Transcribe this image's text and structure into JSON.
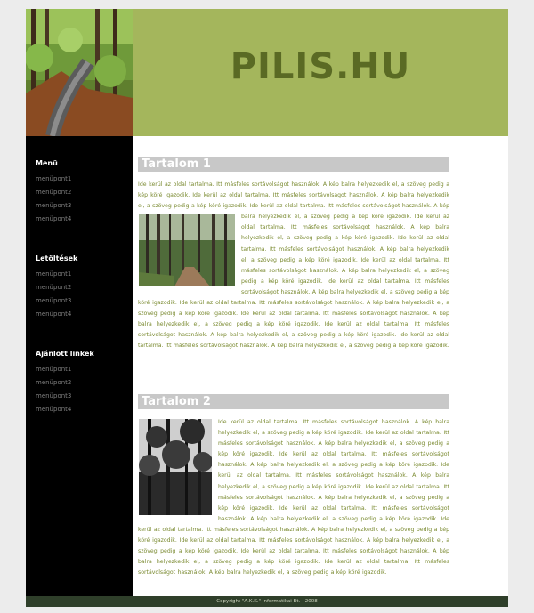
{
  "header": {
    "site_title": "PILIS.HU"
  },
  "sidebar": {
    "groups": [
      {
        "title": "Menü",
        "items": [
          "menüpont1",
          "menüpont2",
          "menüpont3",
          "menüpont4"
        ]
      },
      {
        "title": "Letöltések",
        "items": [
          "menüpont1",
          "menüpont2",
          "menüpont3",
          "menüpont4"
        ]
      },
      {
        "title": "Ajánlott linkek",
        "items": [
          "menüpont1",
          "menüpont2",
          "menüpont3",
          "menüpont4"
        ]
      }
    ]
  },
  "main": {
    "sections": [
      {
        "heading": "Tartalom 1",
        "intro": "Ide kerül az oldal tartalma. Itt másfeles sortávolságot használok. A kép balra helyezkedik el, a szöveg pedig a kép köré igazodik. Ide kerül az oldal tartalma. Itt másfeles sortávolságot használok. A kép balra helyezkedik el, a szöveg pedig a kép köré igazodik. Ide kerül az oldal tartalma. Itt másfeles sortávolságot használok. A kép balra helyezkedik el, a szöveg pedig a kép",
        "body": "köré igazodik. Ide kerül az oldal tartalma. Itt másfeles sortávolságot használok. A kép balra helyezkedik el, a szöveg pedig a kép köré igazodik. Ide kerül az oldal tartalma. Itt másfeles sortávolságot használok. A kép balra helyezkedik el, a szöveg pedig a kép köré igazodik. Ide kerül az oldal tartalma. Itt másfeles sortávolságot használok. A kép balra helyezkedik el, a szöveg pedig a kép köré igazodik. Ide kerül az oldal tartalma. Itt másfeles sortávolságot használok. A kép balra helyezkedik el, a szöveg pedig a kép köré igazodik. Ide kerül az oldal tartalma. Itt másfeles sortávolságot használok. A kép balra helyezkedik el, a szöveg pedig a kép köré igazodik. Ide kerül az oldal tartalma. Itt másfeles sortávolságot használok. A kép balra helyezkedik el, a szöveg pedig a kép köré igazodik. Ide kerül az oldal tartalma. Itt másfeles sortávolságot használok. A kép balra helyezkedik el, a szöveg pedig a kép köré igazodik. Ide kerül az oldal tartalma. Itt másfeles sortávolságot használok. A kép balra helyezkedik el, a szöveg pedig a kép köré igazodik."
      },
      {
        "heading": "Tartalom 2",
        "body": "Ide kerül az oldal tartalma. Itt másfeles sortávolságot használok. A kép balra helyezkedik el, a szöveg pedig a kép köré igazodik. Ide kerül az oldal tartalma. Itt másfeles sortávolságot használok. A kép balra helyezkedik el, a szöveg pedig a kép köré igazodik. Ide kerül az oldal tartalma. Itt másfeles sortávolságot használok. A kép balra helyezkedik el, a szöveg pedig a kép köré igazodik. Ide kerül az oldal tartalma. Itt másfeles sortávolságot használok. A kép balra helyezkedik el, a szöveg pedig a kép köré igazodik. Ide kerül az oldal tartalma. Itt másfeles sortávolságot használok. A kép balra helyezkedik el, a szöveg pedig a kép köré igazodik. Ide kerül az oldal tartalma. Itt másfeles sortávolságot használok. A kép balra helyezkedik el, a szöveg pedig a kép köré igazodik. Ide kerül az oldal tartalma. Itt másfeles sortávolságot használok. A kép balra helyezkedik el, a szöveg pedig a kép köré igazodik. Ide kerül az oldal tartalma. Itt másfeles sortávolságot használok. A kép balra helyezkedik el, a szöveg pedig a kép köré igazodik. Ide kerül az oldal tartalma. Itt másfeles sortávolságot használok. A kép balra helyezkedik el, a szöveg pedig a kép köré igazodik. Ide kerül az oldal tartalma. Itt másfeles sortávolságot használok. A kép balra helyezkedik el, a szöveg pedig a kép köré igazodik."
      }
    ]
  },
  "footer": {
    "text": "Copyright \"A.K.K.\" Informatikai Bt. - 2008"
  },
  "colors": {
    "header_band": "#a4b65c",
    "title": "#5a6a24",
    "sidebar": "#000000",
    "heading_bar": "#c8c8c8",
    "body_text": "#7a8a30",
    "footer": "#2f3f2a"
  }
}
